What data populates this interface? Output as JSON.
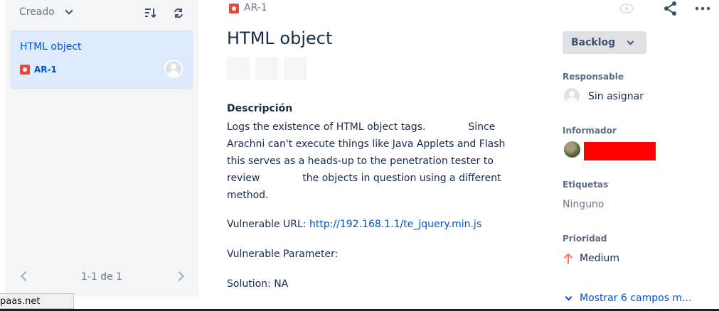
{
  "sidebar": {
    "sort_label": "Creado",
    "sort_icon": "sort-icon",
    "refresh_icon": "refresh-icon",
    "issue": {
      "title": "HTML object",
      "key": "AR-1",
      "type_icon": "bug-icon",
      "assignee_icon": "avatar-icon"
    },
    "pagination": "1-1 de 1"
  },
  "browser_status_url": "paas.net",
  "issue": {
    "key": "AR-1",
    "title": "HTML object",
    "description_heading": "Descripción",
    "description_part1": "Logs the existence of HTML object tags.",
    "description_part2": "Since Arachni can't execute things like Java Applets and Flash this serves as a heads-up to the penetration tester to review",
    "description_part3": "the objects in question using a different method.",
    "vulnerable_url_label": "Vulnerable URL:",
    "vulnerable_url": "http://192.168.1.1/te_jquery.min.js",
    "vulnerable_parameter_label": "Vulnerable Parameter:",
    "solution": "Solution: NA"
  },
  "details": {
    "status": "Backlog",
    "assignee_label": "Responsable",
    "assignee_value": "Sin asignar",
    "reporter_label": "Informador",
    "labels_label": "Etiquetas",
    "labels_value": "Ninguno",
    "priority_label": "Prioridad",
    "priority_value": "Medium",
    "priority_color": "#ff7452",
    "show_more": "Mostrar 6 campos m..."
  },
  "colors": {
    "accent": "#0052cc",
    "selected_bg": "#deebff",
    "panel_bg": "#f4f5f7",
    "bug": "#e5493a"
  }
}
